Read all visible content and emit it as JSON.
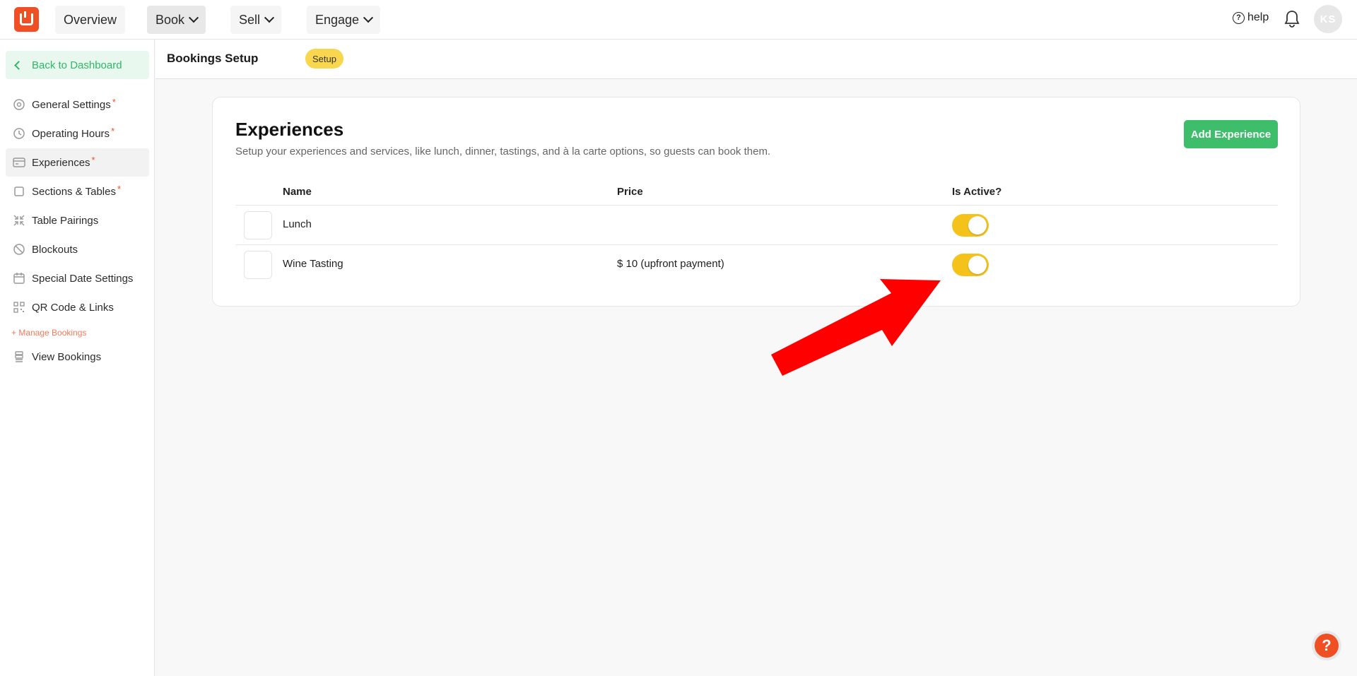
{
  "nav": {
    "overview": "Overview",
    "book": "Book",
    "sell": "Sell",
    "engage": "Engage",
    "help": "help",
    "avatar_initials": "KS"
  },
  "sidebar": {
    "back": "Back to Dashboard",
    "items": [
      {
        "label": "General Settings",
        "icon": "settings-icon",
        "required": true
      },
      {
        "label": "Operating Hours",
        "icon": "clock-icon",
        "required": true
      },
      {
        "label": "Experiences",
        "icon": "card-icon",
        "required": true,
        "active": true
      },
      {
        "label": "Sections & Tables",
        "icon": "square-icon",
        "required": true
      },
      {
        "label": "Table Pairings",
        "icon": "merge-icon",
        "required": false
      },
      {
        "label": "Blockouts",
        "icon": "block-icon",
        "required": false
      },
      {
        "label": "Special Date Settings",
        "icon": "calendar-icon",
        "required": false
      },
      {
        "label": "QR Code & Links",
        "icon": "qr-icon",
        "required": false
      }
    ],
    "manage_label": "+ Manage Bookings",
    "view_bookings": "View Bookings",
    "required_mark": "*"
  },
  "header": {
    "title": "Bookings Setup",
    "badge": "Setup"
  },
  "experiences": {
    "title": "Experiences",
    "description": "Setup your experiences and services, like lunch, dinner, tastings, and à la carte options, so guests can book them.",
    "add_button": "Add Experience",
    "columns": {
      "name": "Name",
      "price": "Price",
      "active": "Is Active?"
    },
    "rows": [
      {
        "name": "Lunch",
        "price": "",
        "active": true
      },
      {
        "name": "Wine Tasting",
        "price": "$ 10 (upfront payment)",
        "active": true
      }
    ]
  },
  "colors": {
    "brand": "#f04e23",
    "green": "#3ebd6b",
    "toggle": "#f5c21b",
    "annotation_arrow": "#ff0000"
  },
  "fab": {
    "label": "?"
  }
}
